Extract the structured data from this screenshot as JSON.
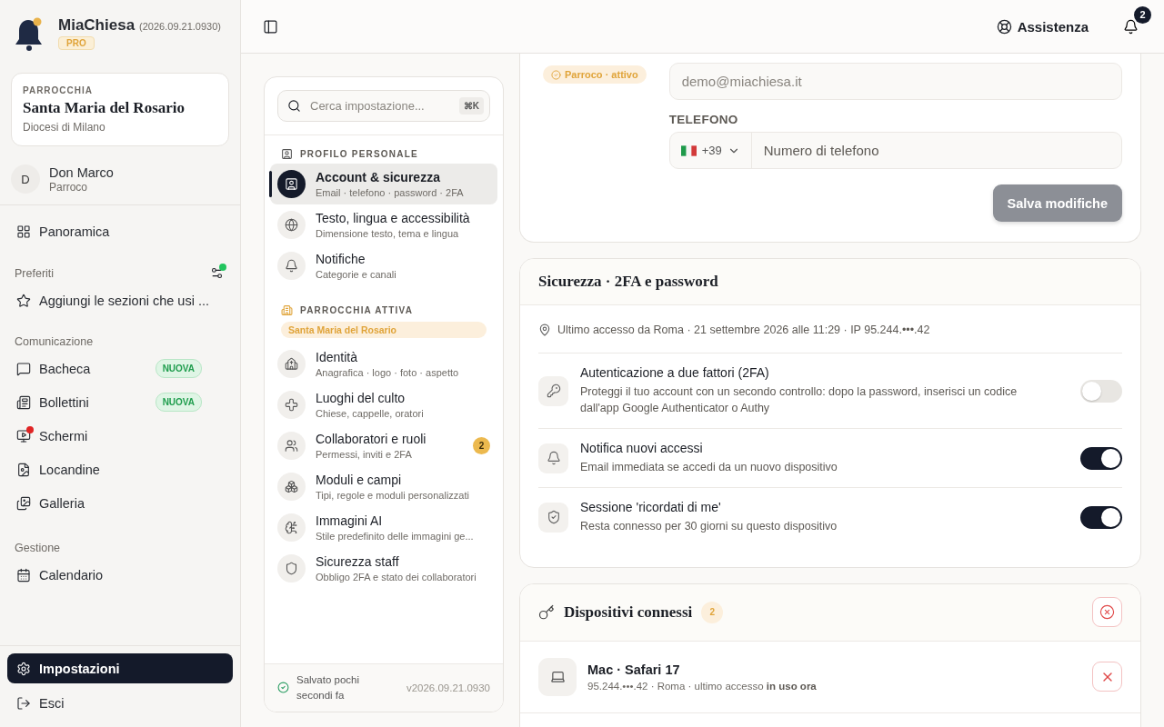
{
  "app": {
    "name": "MiaChiesa",
    "version": "(2026.09.21.0930)",
    "plan": "PRO"
  },
  "parish": {
    "label": "PARROCCHIA",
    "name": "Santa Maria del Rosario",
    "diocese": "Diocesi di Milano"
  },
  "user": {
    "initial": "D",
    "name": "Don Marco",
    "role": "Parroco"
  },
  "nav_top": [
    {
      "label": "Panoramica",
      "selected": false
    }
  ],
  "favorites": {
    "title": "Preferiti",
    "hint": "Aggiungi le sezioni che usi ...",
    "has_update": true
  },
  "nav_sections": [
    {
      "title": "Comunicazione",
      "items": [
        {
          "label": "Bacheca",
          "badge": "NUOVA",
          "alert": false,
          "selected": false
        },
        {
          "label": "Bollettini",
          "badge": "NUOVA",
          "alert": false,
          "selected": false
        },
        {
          "label": "Schermi",
          "alert": true,
          "selected": false
        },
        {
          "label": "Locandine",
          "alert": false,
          "selected": false
        },
        {
          "label": "Galleria",
          "alert": false,
          "selected": false
        }
      ]
    },
    {
      "title": "Gestione",
      "items": [
        {
          "label": "Calendario",
          "alert": false,
          "selected": false
        }
      ]
    }
  ],
  "nav_bottom": [
    {
      "label": "Impostazioni",
      "selected": true
    },
    {
      "label": "Esci",
      "selected": false
    }
  ],
  "topbar": {
    "help": "Assistenza",
    "notifications": "2"
  },
  "settings_nav": {
    "search_placeholder": "Cerca impostazione...",
    "shortcut": "⌘K",
    "groups": [
      {
        "title": "PROFILO PERSONALE",
        "kind": "personal",
        "items": [
          {
            "title": "Account & sicurezza",
            "subtitle": "Email · telefono · password · 2FA",
            "selected": true
          },
          {
            "title": "Testo, lingua e accessibilità",
            "subtitle": "Dimensione testo, tema e lingua",
            "selected": false
          },
          {
            "title": "Notifiche",
            "subtitle": "Categorie e canali",
            "selected": false
          }
        ]
      },
      {
        "title": "PARROCCHIA ATTIVA",
        "kind": "parish",
        "tag": "Santa Maria del Rosario",
        "items": [
          {
            "title": "Identità",
            "subtitle": "Anagrafica · logo · foto · aspetto",
            "selected": false
          },
          {
            "title": "Luoghi del culto",
            "subtitle": "Chiese, cappelle, oratori",
            "selected": false
          },
          {
            "title": "Collaboratori e ruoli",
            "subtitle": "Permessi, inviti e 2FA",
            "badge": "2",
            "selected": false
          },
          {
            "title": "Moduli e campi",
            "subtitle": "Tipi, regole e moduli personalizzati",
            "selected": false
          },
          {
            "title": "Immagini AI",
            "subtitle": "Stile predefinito delle immagini ge...",
            "selected": false
          },
          {
            "title": "Sicurezza staff",
            "subtitle": "Obbligo 2FA e stato dei collaboratori",
            "selected": false
          }
        ]
      }
    ],
    "footer_status": "Salvato pochi secondi fa",
    "footer_version": "v2026.09.21.0930"
  },
  "profile": {
    "role_badge": "Parroco · attivo",
    "email": {
      "value": "demo@miachiesa.it",
      "disabled": true
    },
    "phone": {
      "label": "TELEFONO",
      "country_code": "+39",
      "placeholder": "Numero di telefono"
    },
    "save": {
      "label": "Salva modifiche",
      "disabled": true
    }
  },
  "security": {
    "title": "Sicurezza · 2FA e password",
    "last_access": "Ultimo accesso da Roma · 21 settembre 2026 alle 11:29 · IP 95.244.•••.42",
    "settings": [
      {
        "title": "Autenticazione a due fattori (2FA)",
        "description": "Proteggi il tuo account con un secondo controllo: dopo la password, inserisci un codice dall'app Google Authenticator o Authy",
        "on": false
      },
      {
        "title": "Notifica nuovi accessi",
        "description": "Email immediata se accedi da un nuovo dispositivo",
        "on": true
      },
      {
        "title": "Sessione 'ricordati di me'",
        "description": "Resta connesso per 30 giorni su questo dispositivo",
        "on": true
      }
    ]
  },
  "devices": {
    "title": "Dispositivi connessi",
    "count": "2",
    "items": [
      {
        "name": "Mac · Safari 17",
        "detail": "95.244.•••.42 · Roma · ultimo accesso **in uso ora**"
      }
    ]
  }
}
